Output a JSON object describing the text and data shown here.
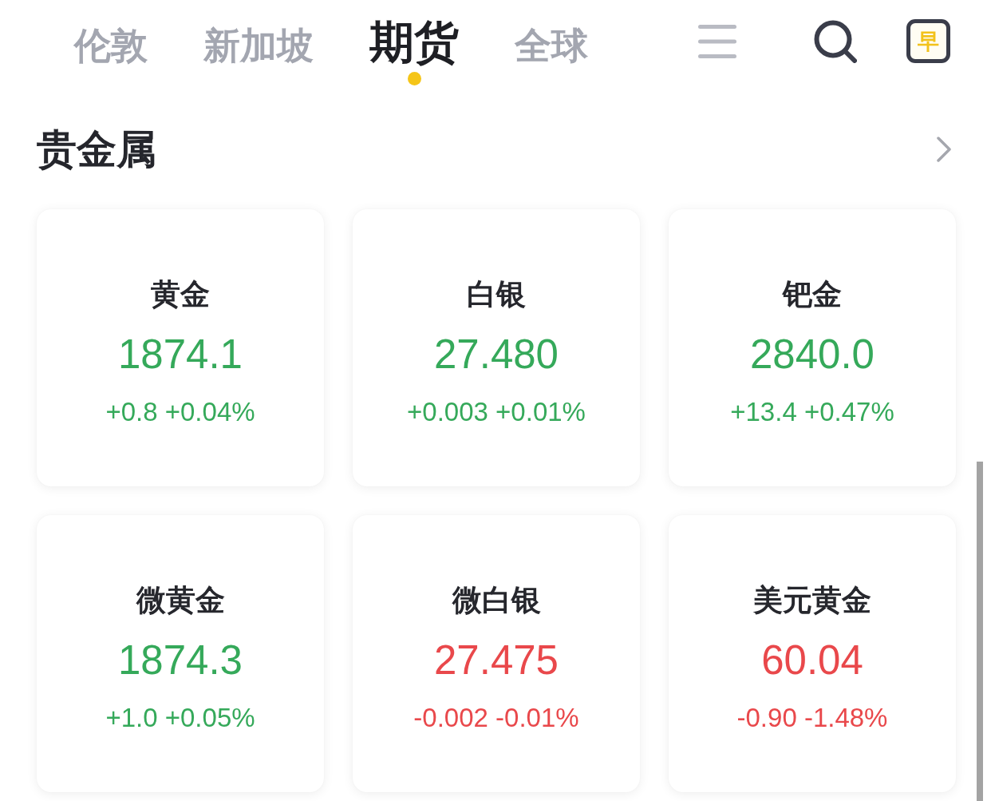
{
  "tabs": [
    {
      "label": "伦敦",
      "selected": false
    },
    {
      "label": "新加坡",
      "selected": false
    },
    {
      "label": "期货",
      "selected": true
    },
    {
      "label": "全球",
      "selected": false
    }
  ],
  "toolbar": {
    "badge": "早"
  },
  "section": {
    "title": "贵金属"
  },
  "cards": [
    {
      "name": "黄金",
      "price": "1874.1",
      "change": "+0.8 +0.04%",
      "rising": true
    },
    {
      "name": "白银",
      "price": "27.480",
      "change": "+0.003 +0.01%",
      "rising": true
    },
    {
      "name": "钯金",
      "price": "2840.0",
      "change": "+13.4 +0.47%",
      "rising": true
    },
    {
      "name": "微黄金",
      "price": "1874.3",
      "change": "+1.0 +0.05%",
      "rising": true
    },
    {
      "name": "微白银",
      "price": "27.475",
      "change": "-0.002 -0.01%",
      "rising": false
    },
    {
      "name": "美元黄金",
      "price": "60.04",
      "change": "-0.90 -1.48%",
      "rising": false
    }
  ]
}
